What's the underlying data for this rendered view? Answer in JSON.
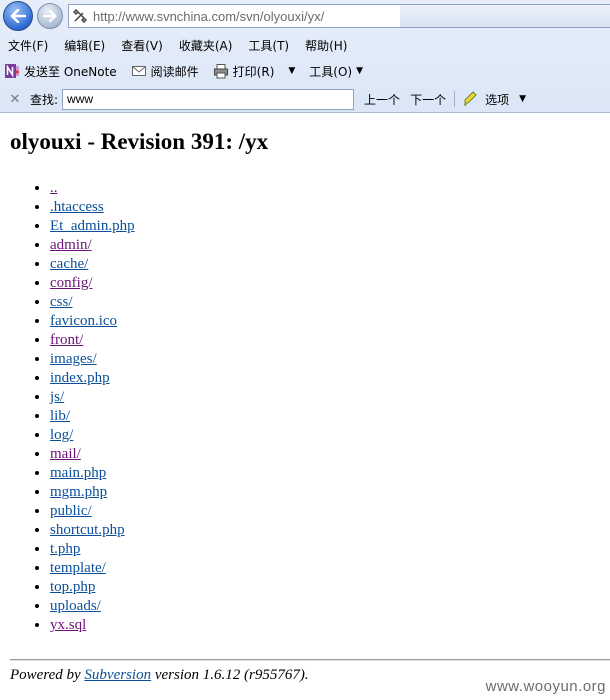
{
  "browser": {
    "url": "http://www.svnchina.com/svn/olyouxi/yx/",
    "menu": [
      "文件(F)",
      "编辑(E)",
      "查看(V)",
      "收藏夹(A)",
      "工具(T)",
      "帮助(H)"
    ],
    "commands": {
      "onenote": "发送至 OneNote",
      "mail": "阅读邮件",
      "print": "打印(R)",
      "tools": "工具(O)"
    },
    "find": {
      "label": "查找:",
      "value": "www",
      "prev": "上一个",
      "next": "下一个",
      "options": "选项"
    }
  },
  "page": {
    "title": "olyouxi - Revision 391: /yx",
    "entries": [
      {
        "name": "..",
        "visited": true
      },
      {
        "name": ".htaccess",
        "visited": false
      },
      {
        "name": "Et_admin.php",
        "visited": false
      },
      {
        "name": "admin/",
        "visited": true
      },
      {
        "name": "cache/",
        "visited": false
      },
      {
        "name": "config/",
        "visited": true
      },
      {
        "name": "css/",
        "visited": false
      },
      {
        "name": "favicon.ico",
        "visited": false
      },
      {
        "name": "front/",
        "visited": true
      },
      {
        "name": "images/",
        "visited": false
      },
      {
        "name": "index.php",
        "visited": false
      },
      {
        "name": "js/",
        "visited": false
      },
      {
        "name": "lib/",
        "visited": false
      },
      {
        "name": "log/",
        "visited": false
      },
      {
        "name": "mail/",
        "visited": true
      },
      {
        "name": "main.php",
        "visited": false
      },
      {
        "name": "mgm.php",
        "visited": false
      },
      {
        "name": "public/",
        "visited": false
      },
      {
        "name": "shortcut.php",
        "visited": false
      },
      {
        "name": "t.php",
        "visited": false
      },
      {
        "name": "template/",
        "visited": false
      },
      {
        "name": "top.php",
        "visited": false
      },
      {
        "name": "uploads/",
        "visited": false
      },
      {
        "name": "yx.sql",
        "visited": true
      }
    ],
    "footer": {
      "prefix": "Powered by",
      "link": "Subversion",
      "suffix": "version 1.6.12 (r955767)."
    }
  },
  "watermark": "www.wooyun.org",
  "colors": {
    "link": "#0b4f9a",
    "visited": "#6b1477"
  }
}
